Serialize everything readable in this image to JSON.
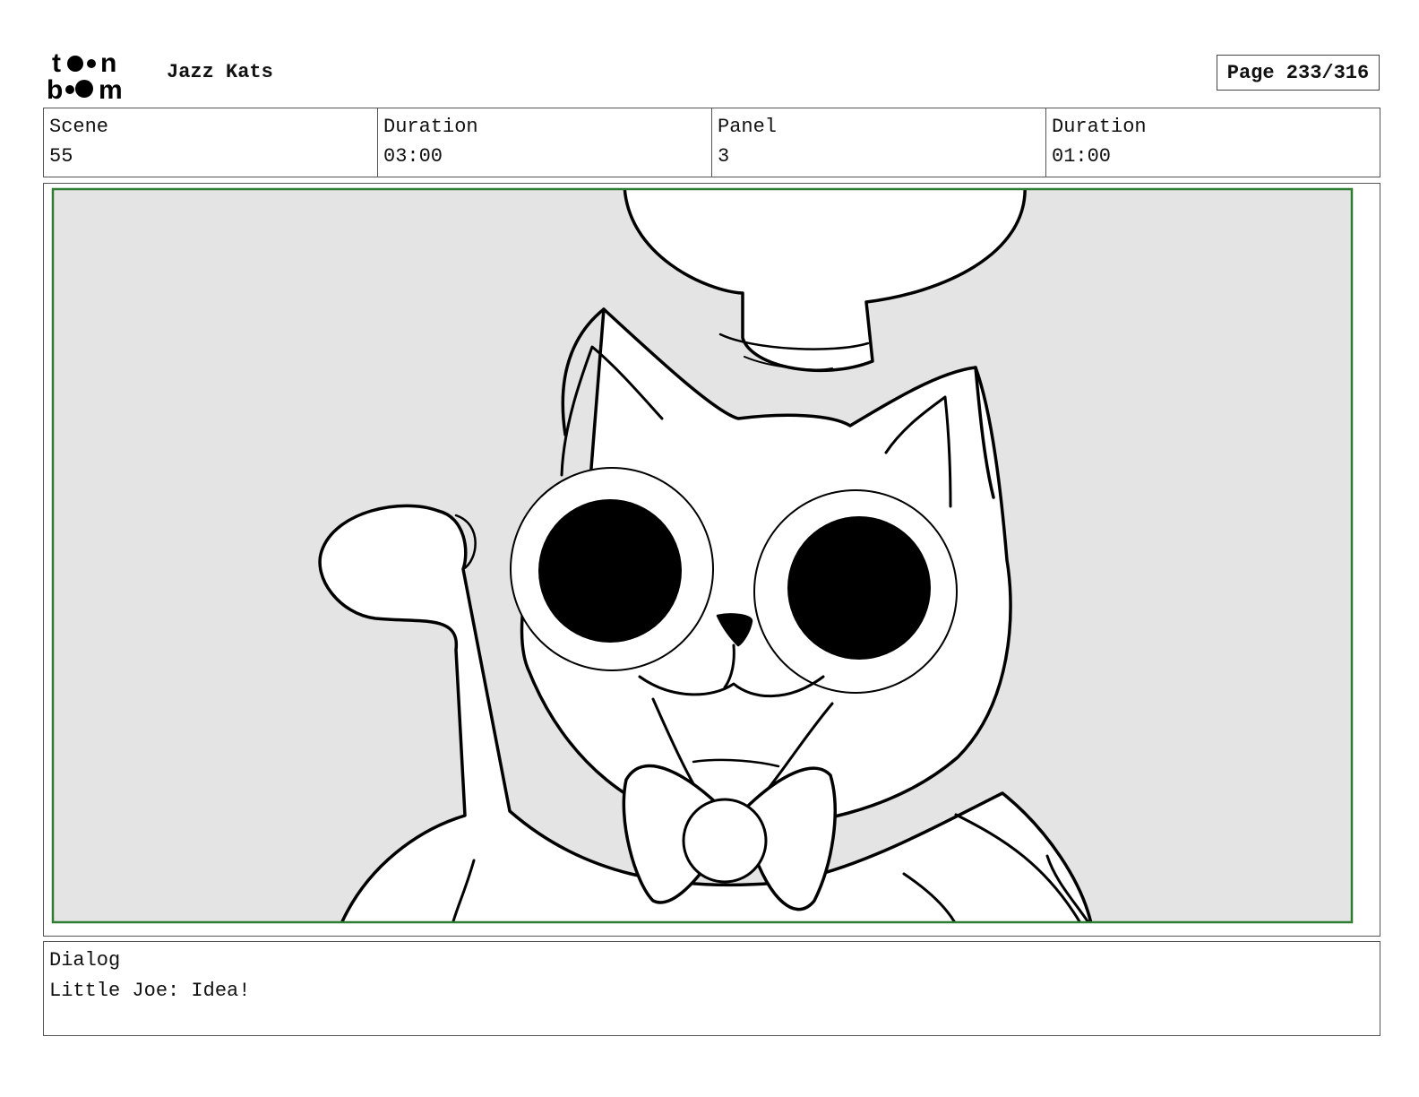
{
  "header": {
    "logo_text": "toon boom",
    "project_title": "Jazz Kats",
    "page_label": "Page 233/316"
  },
  "info": [
    {
      "label": "Scene",
      "value": "55"
    },
    {
      "label": "Duration",
      "value": "03:00"
    },
    {
      "label": "Panel",
      "value": "3"
    },
    {
      "label": "Duration",
      "value": "01:00"
    }
  ],
  "dialog": {
    "label": "Dialog",
    "text": "Little Joe: Idea!"
  },
  "colors": {
    "safe_frame": "#2e7d32",
    "panel_background": "#e4e4e4"
  }
}
